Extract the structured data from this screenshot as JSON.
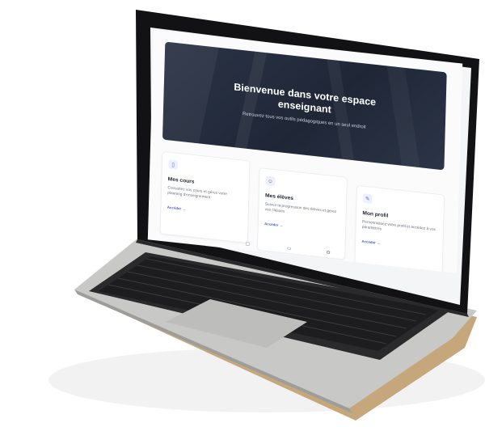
{
  "hero": {
    "title_line1": "Bienvenue dans votre espace",
    "title_line2": "enseignant",
    "subtitle": "Retrouvez tous vos outils pédagogiques en un seul endroit"
  },
  "cards": [
    {
      "icon": "book-icon",
      "title": "Mes cours",
      "description": "Consultez vos cours et gérez votre planning d'enseignement",
      "link": "Accéder →"
    },
    {
      "icon": "students-icon",
      "title": "Mes élèves",
      "description": "Suivez la progression des élèves et gérez vos classes",
      "link": "Accéder →"
    },
    {
      "icon": "profile-icon",
      "title": "Mon profil",
      "description": "Personnalisez votre profil et accédez à vos paramètres",
      "link": "Accéder →"
    }
  ],
  "bottom_nav": [
    "calendar-icon",
    "message-icon",
    "settings-icon"
  ],
  "colors": {
    "accent": "#4a5bd6",
    "hero_bg": "#232c3d",
    "laptop_silver": "#c9c9c7",
    "keyboard": "#1c1c1e"
  }
}
